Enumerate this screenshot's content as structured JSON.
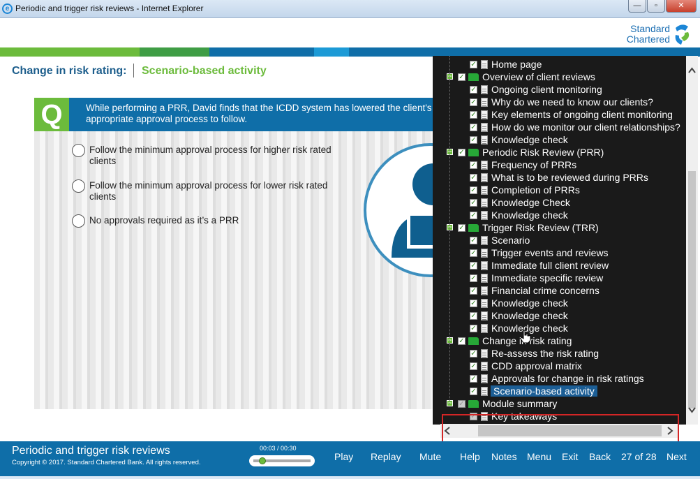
{
  "window": {
    "title": "Periodic and trigger risk reviews - Internet Explorer",
    "minimize": "—",
    "restore": "▫",
    "close": "✕"
  },
  "brand": {
    "line1": "Standard",
    "line2": "Chartered"
  },
  "breadcrumb": {
    "section": "Change in risk rating:",
    "page": "Scenario-based activity"
  },
  "question": {
    "badge": "Q",
    "text": "While performing a PRR, David finds that the ICDD system has lowered the client's the appropriate approval process to follow.",
    "options": [
      "Follow the minimum approval process for higher risk rated clients",
      "Follow the minimum approval process for lower risk rated clients",
      "No approvals required as it’s a PRR"
    ]
  },
  "toc": {
    "items": [
      {
        "label": "Home page",
        "level": 2,
        "type": "page"
      },
      {
        "label": "Overview of client reviews",
        "level": 1,
        "type": "folder"
      },
      {
        "label": "Ongoing client monitoring",
        "level": 2,
        "type": "page"
      },
      {
        "label": "Why do we need to know our clients?",
        "level": 2,
        "type": "page"
      },
      {
        "label": "Key elements of ongoing client monitoring",
        "level": 2,
        "type": "page"
      },
      {
        "label": "How do we monitor our client relationships?",
        "level": 2,
        "type": "page"
      },
      {
        "label": "Knowledge check",
        "level": 2,
        "type": "page"
      },
      {
        "label": "Periodic Risk Review (PRR)",
        "level": 1,
        "type": "folder"
      },
      {
        "label": "Frequency of PRRs",
        "level": 2,
        "type": "page"
      },
      {
        "label": "What is to be reviewed during PRRs",
        "level": 2,
        "type": "page"
      },
      {
        "label": "Completion of PRRs",
        "level": 2,
        "type": "page"
      },
      {
        "label": "Knowledge Check",
        "level": 2,
        "type": "page"
      },
      {
        "label": "Knowledge check",
        "level": 2,
        "type": "page"
      },
      {
        "label": "Trigger Risk Review (TRR)",
        "level": 1,
        "type": "folder"
      },
      {
        "label": "Scenario",
        "level": 2,
        "type": "page"
      },
      {
        "label": "Trigger events and reviews",
        "level": 2,
        "type": "page"
      },
      {
        "label": "Immediate full client review",
        "level": 2,
        "type": "page"
      },
      {
        "label": "Immediate specific review",
        "level": 2,
        "type": "page"
      },
      {
        "label": "Financial crime concerns",
        "level": 2,
        "type": "page"
      },
      {
        "label": "Knowledge check",
        "level": 2,
        "type": "page"
      },
      {
        "label": "Knowledge check",
        "level": 2,
        "type": "page"
      },
      {
        "label": "Knowledge check",
        "level": 2,
        "type": "page"
      },
      {
        "label": "Change in risk rating",
        "level": 1,
        "type": "folder"
      },
      {
        "label": "Re-assess the risk rating",
        "level": 2,
        "type": "page"
      },
      {
        "label": "CDD approval matrix",
        "level": 2,
        "type": "page"
      },
      {
        "label": "Approvals for change in risk ratings",
        "level": 2,
        "type": "page"
      },
      {
        "label": "Scenario-based activity",
        "level": 2,
        "type": "page",
        "active": true
      },
      {
        "label": "Module summary",
        "level": 1,
        "type": "folder",
        "dim": true
      },
      {
        "label": "Key takeaways",
        "level": 2,
        "type": "page",
        "dim": true
      }
    ]
  },
  "footer": {
    "course_title": "Periodic and trigger risk reviews",
    "copyright": "Copyright © 2017. Standard Chartered Bank. All rights reserved.",
    "timecode": "00:03 / 00:30",
    "progress_fraction": 0.1,
    "buttons": {
      "play": "Play",
      "replay": "Replay",
      "mute": "Mute",
      "help": "Help",
      "notes": "Notes",
      "menu": "Menu",
      "exit": "Exit",
      "back": "Back",
      "next": "Next"
    },
    "page_counter": "27 of 28"
  },
  "colors": {
    "brand_blue": "#0f6ea8",
    "brand_green": "#6cbb3c",
    "toc_bg": "#1a1a1a",
    "highlight_red": "#d42626"
  }
}
